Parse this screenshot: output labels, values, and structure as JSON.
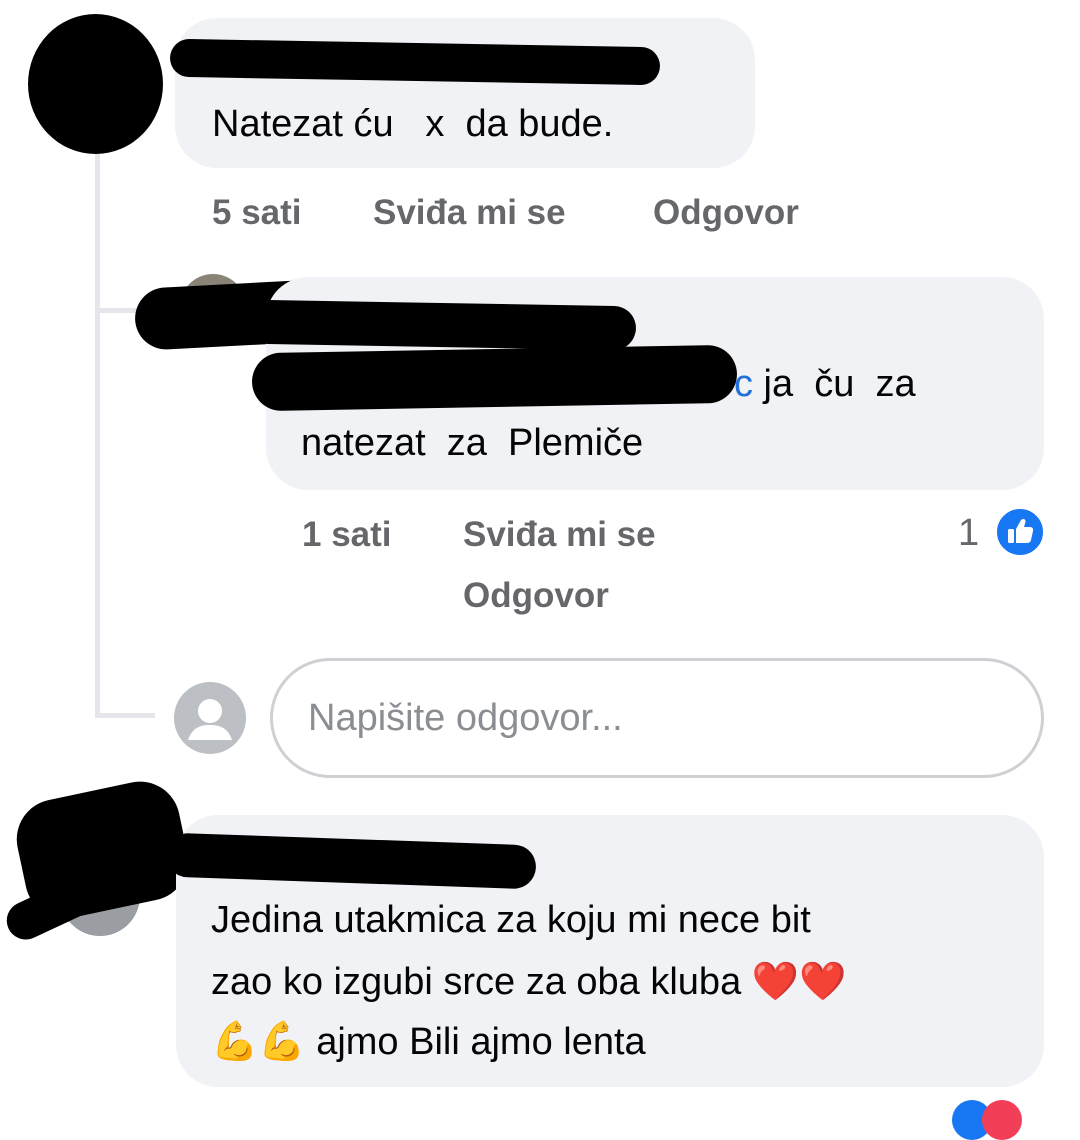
{
  "comments": [
    {
      "text": "Natezat ću   x  da bude.",
      "time": "5 sati",
      "like_label": "Sviđa mi se",
      "reply_label": "Odgovor"
    },
    {
      "mention_tail": "c",
      "text_line1": " ja  ču  za",
      "text_line2": "natezat  za  Plemiče",
      "time": "1 sati",
      "like_label": "Sviđa mi se",
      "reply_label": "Odgovor",
      "reaction_count": "1"
    },
    {
      "text_line1": "Jedina utakmica za koju mi nece bit",
      "text_line2": "zao ko izgubi srce za oba kluba",
      "hearts": "❤️❤️",
      "flex": "💪💪",
      "text_line3": " ajmo Bili ajmo lenta"
    }
  ],
  "reply_input": {
    "placeholder": "Napišite odgovor..."
  },
  "colors": {
    "bubble": "#f0f2f5",
    "meta": "#65676b",
    "mention": "#216fdb",
    "like_blue": "#1877f2"
  }
}
